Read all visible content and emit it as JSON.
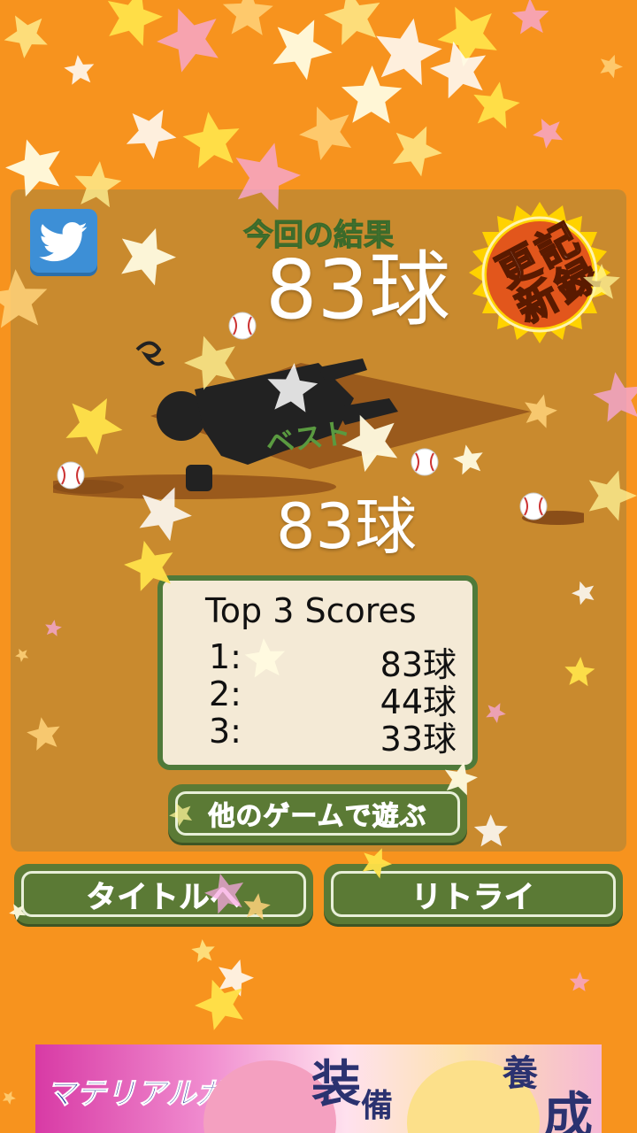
{
  "header": {
    "result_title": "今回の結果",
    "current_score": "83球",
    "record_badge": "記録更新"
  },
  "field": {
    "best_label": "ベスト",
    "best_score": "83球"
  },
  "scoreboard": {
    "title": "Top 3 Scores",
    "rows": [
      {
        "rank": "1:",
        "value": "83球"
      },
      {
        "rank": "2:",
        "value": "44球"
      },
      {
        "rank": "3:",
        "value": "33球"
      }
    ]
  },
  "buttons": {
    "other_games": "他のゲームで遊ぶ",
    "title": "タイトルへ",
    "retry": "リトライ"
  },
  "ad": {
    "logo": "マテリアルガールズ",
    "kanji1": "装",
    "kanji2": "備",
    "kanji3": "養",
    "kanji4": "成"
  },
  "icons": {
    "twitter": "twitter-icon",
    "badge": "starburst-badge-icon",
    "ball": "baseball-icon"
  },
  "colors": {
    "background": "#f7931e",
    "panel": "#c98a2e",
    "button": "#5b7a35",
    "badge_outer": "#ffd200",
    "badge_inner": "#e2561c",
    "twitter": "#3d8fd6"
  }
}
